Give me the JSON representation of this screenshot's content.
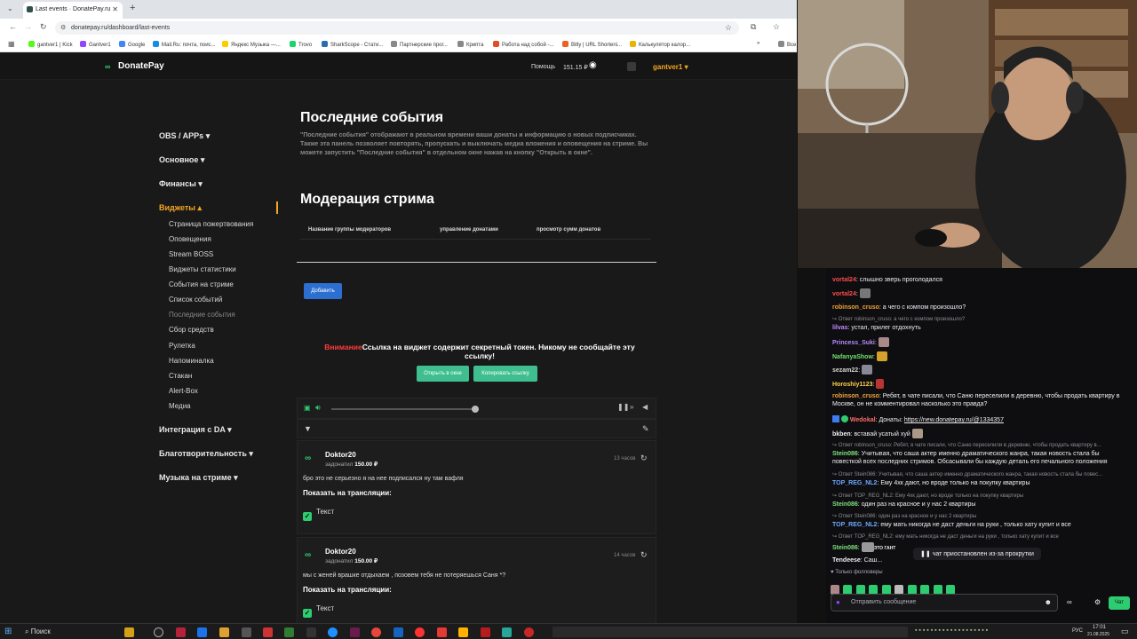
{
  "browser": {
    "tab_title": "Last events · DonatePay.ru",
    "url": "donatepay.ru/dashboard/last-events",
    "bookmarks": [
      "gantver1 | Kick",
      "Gantver1",
      "Google",
      "Mail.Ru: почта, поис...",
      "Яндекс Музыка —...",
      "Trovo",
      "SharkScope - Стати...",
      "Партнерские прог...",
      "Крипта",
      "Работа над собой -...",
      "Bitly | URL Shorteni...",
      "Калькулятор калор..."
    ],
    "bookmarks_more": "Все"
  },
  "site": {
    "logo": "DonatePay",
    "help": "Помощь",
    "balance": "151.15 ₽",
    "username": "gantver1",
    "nav": {
      "obs": "OBS / APPs",
      "main": "Основное",
      "finance": "Финансы",
      "widgets": "Виджеты",
      "widget_items": [
        "Страница пожертвования",
        "Оповещения",
        "Stream BOSS",
        "Виджеты статистики",
        "События на стриме",
        "Список событий",
        "Последние события",
        "Сбор средств",
        "Рулетка",
        "Напоминалка",
        "Стакан",
        "Alert-Box",
        "Медиа"
      ],
      "integration": "Интеграция с DA",
      "charity": "Благотворительность",
      "music": "Музыка на стриме"
    },
    "page_title": "Последние события",
    "page_desc": "\"Последние события\" отображают в реальном времени ваши донаты и информацию о новых подписчиках. Также эта панель позволяет повторять, пропускать и выключать медиа вложения и оповещения на стриме. Вы можете запустить \"Последние события\" в отдельном окне нажав на кнопку \"Открыть в окне\".",
    "moderation_title": "Модерация стрима",
    "table_headers": [
      "Название группы модераторов",
      "управление донатами",
      "просмотр сумм донатов"
    ],
    "add_button": "Добавить",
    "warning_label": "Внимание",
    "warning_text": "Ссылка на виджет содержит секретный токен. Никому не сообщайте эту ссылку!",
    "open_window": "Открыть в окне",
    "copy_link": "Копировать ссылку",
    "events": [
      {
        "name": "Doktor20",
        "action": "задонатил",
        "amount": "150.00 ₽",
        "time": "13 часов",
        "message": "бро это не серьезно я на нее подписался ну там вафля",
        "show_label": "Показать на трансляции:",
        "option": "Текст"
      },
      {
        "name": "Doktor20",
        "action": "задонатил",
        "amount": "150.00 ₽",
        "time": "14 часов",
        "message": "мы с женей врашке отдыхаем , позовем тебя не потеряешься Саня *?",
        "show_label": "Показать на трансляции:",
        "option": "Текст"
      }
    ]
  },
  "chat": {
    "messages": [
      {
        "type": "msg",
        "user": "vortal24",
        "color": "#ff4b4b",
        "text": "слышно зверь проголодался"
      },
      {
        "type": "msg",
        "user": "vortal24",
        "color": "#ff4b4b",
        "text": ""
      },
      {
        "type": "msg",
        "user": "robinson_cruso",
        "color": "#f0a33b",
        "text": "а чего с компом произошло?"
      },
      {
        "type": "reply",
        "text": "Ответ robinson_cruso: а чего с компом произошло?"
      },
      {
        "type": "msg",
        "user": "lilvas",
        "color": "#c98bff",
        "text": "устал, прилег отдохнуть"
      },
      {
        "type": "msg",
        "user": "Princess_Suki",
        "color": "#b58cff",
        "text": ""
      },
      {
        "type": "msg",
        "user": "NafanyaShow",
        "color": "#6ee06e",
        "text": ""
      },
      {
        "type": "msg",
        "user": "sezam22",
        "color": "#d8d8d8",
        "text": ""
      },
      {
        "type": "msg",
        "user": "Horoshiy1123",
        "color": "#ffd24a",
        "text": ""
      },
      {
        "type": "msg",
        "user": "robinson_cruso",
        "color": "#f0a33b",
        "text": "Ребят, в чате писали, что Саню переселили в деревню, чтобы продать квартиру в Москве, он не комментировал насколько это правда?"
      },
      {
        "type": "msg",
        "user": "Wedokal",
        "color": "#ff6b6b",
        "text": "Донаты: ",
        "link": "https://new.donatepay.ru/@1334357"
      },
      {
        "type": "msg",
        "user": "bkben",
        "color": "#efeff1",
        "text": "вставай усатый хуй"
      },
      {
        "type": "reply",
        "text": "Ответ robinson_cruso: Ребят, в чате писали, что Саню переселили в деревню, чтобы продать квартиру в..."
      },
      {
        "type": "msg",
        "user": "Stein086",
        "color": "#7ee07e",
        "text": "Учитывая, что саша актер именно драматического жанра, такая новость стала бы повесткой всех последних стримов. Обсасывали бы каждую деталь его печального положения"
      },
      {
        "type": "reply",
        "text": "Ответ Stein086: Учитывая, что саша актер именно драматического жанра, такая новость стала бы повес..."
      },
      {
        "type": "msg",
        "user": "TOP_REG_NL2",
        "color": "#6fa8ff",
        "text": "Ему 4хк дают, но вроде только на покупку квартиры"
      },
      {
        "type": "reply",
        "text": "Ответ TOP_REG_NL2: Ему 4хк дают, но вроде только на покупку квартиры"
      },
      {
        "type": "msg",
        "user": "Stein086",
        "color": "#7ee07e",
        "text": "один раз на красное и у нас 2 квартиры"
      },
      {
        "type": "reply",
        "text": "Ответ Stein086: один раз на красное и у нас 2 квартиры"
      },
      {
        "type": "msg",
        "user": "TOP_REG_NL2",
        "color": "#6fa8ff",
        "text": "ему мать никогда не даст деньги на руки , только хату купит и все"
      },
      {
        "type": "reply",
        "text": "Ответ TOP_REG_NL2: ему мать никогда не даст деньги на руки , только хату купит и все"
      },
      {
        "type": "msg",
        "user": "Stein086",
        "color": "#7ee07e",
        "text": ""
      },
      {
        "type": "msg",
        "user": "Tendeese",
        "color": "#efeff1",
        "text": "Саш..."
      }
    ],
    "emote_text": "ЭТО ГАНТ",
    "paused": "чат приостановлен из-за прокрутки",
    "followers_only": "Только фолловеры",
    "input_placeholder": "Отправить сообщение",
    "send": "Чат"
  },
  "taskbar": {
    "search": "Поиск",
    "lang": "РУС",
    "time": "17:01",
    "date": "21.08.2025"
  },
  "colors": {
    "accent_orange": "#f5a623",
    "donate_green": "#2ecc71",
    "twitch_purple": "#9147ff",
    "warning_red": "#ff3b3b"
  }
}
